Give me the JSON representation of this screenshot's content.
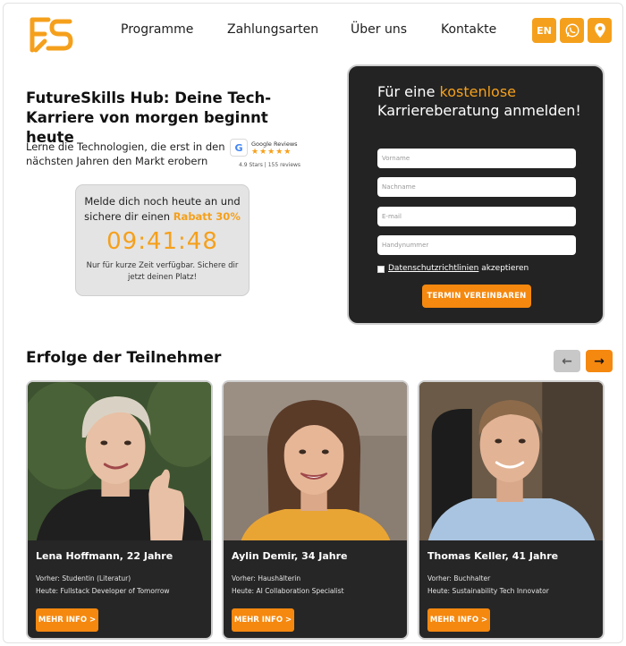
{
  "header": {
    "logo_text": "FS",
    "nav": [
      "Programme",
      "Zahlungsarten",
      "Über uns",
      "Kontakte"
    ],
    "lang_label": "EN",
    "icons": [
      "whatsapp-icon",
      "location-pin-icon"
    ],
    "accent_color": "#f5a01c"
  },
  "hero": {
    "title": "FutureSkills Hub: Deine Tech-Karriere von morgen beginnt heute",
    "subtitle": "Lerne die Technologien, die erst in den nächsten Jahren den Markt erobern",
    "reviews": {
      "label": "Google Reviews",
      "stars": "★★★★★",
      "meta": "4.9 Stars | 155 reviews"
    }
  },
  "timer": {
    "text_before": "Melde dich noch heute an und sichere dir einen ",
    "discount": "Rabatt 30%",
    "clock": "09:41:48",
    "note": "Nur für kurze Zeit verfügbar. Sichere dir jetzt deinen Platz!"
  },
  "form": {
    "title_prefix": "Für eine ",
    "title_accent": "kostenlose",
    "title_rest": "Karriereberatung anmelden!",
    "fields": {
      "first_name": "Vorname",
      "last_name": "Nachname",
      "email": "E-mail",
      "phone": "Handynummer"
    },
    "consent_link": "Datenschutzrichtlinien",
    "consent_rest": " akzeptieren",
    "submit": "TERMIN VEREINBAREN"
  },
  "success": {
    "title": "Erfolge der Teilnehmer",
    "prev_arrow": "←",
    "next_arrow": "→",
    "cards": [
      {
        "name": "Lena Hoffmann, 22 Jahre",
        "previous": "Vorher: Studentin (Literatur)",
        "now": "Heute: Fullstack Developer of Tomorrow",
        "button": "MEHR INFO >"
      },
      {
        "name": "Aylin Demir, 34 Jahre",
        "previous": "Vorher: Haushälterin",
        "now": "Heute: AI Collaboration Specialist",
        "button": "MEHR INFO >"
      },
      {
        "name": "Thomas Keller, 41 Jahre",
        "previous": "Vorher: Buchhalter",
        "now": "Heute: Sustainability Tech Innovator",
        "button": "MEHR INFO >"
      }
    ]
  }
}
